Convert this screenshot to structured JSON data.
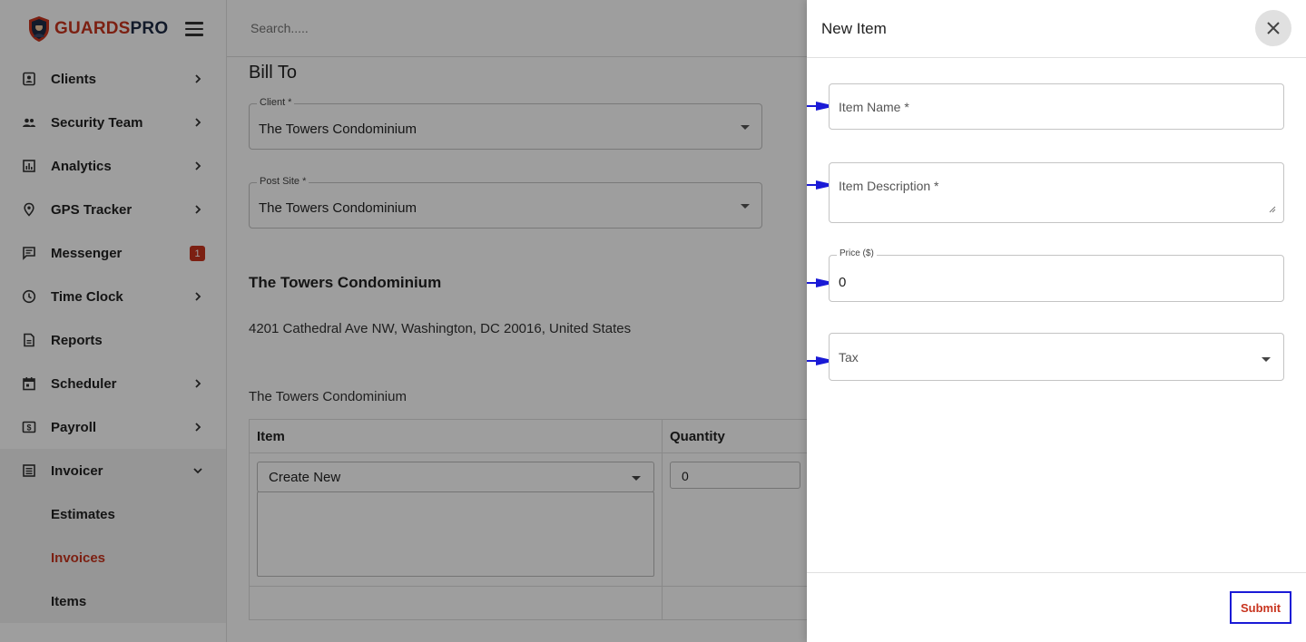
{
  "brand": {
    "logo_part1": "GUARDS",
    "logo_part2": "PRO"
  },
  "search": {
    "placeholder": "Search....."
  },
  "sidebar": {
    "items": [
      {
        "label": "Clients",
        "icon": "contact-icon",
        "chevron": true
      },
      {
        "label": "Security Team",
        "icon": "people-icon",
        "chevron": true
      },
      {
        "label": "Analytics",
        "icon": "bar-chart-icon",
        "chevron": true
      },
      {
        "label": "GPS Tracker",
        "icon": "location-pin-icon",
        "chevron": true
      },
      {
        "label": "Messenger",
        "icon": "chat-icon",
        "badge": "1"
      },
      {
        "label": "Time Clock",
        "icon": "clock-icon",
        "chevron": true
      },
      {
        "label": "Reports",
        "icon": "document-icon",
        "chevron": false
      },
      {
        "label": "Scheduler",
        "icon": "calendar-icon",
        "chevron": true
      },
      {
        "label": "Payroll",
        "icon": "dollar-icon",
        "chevron": true
      },
      {
        "label": "Invoicer",
        "icon": "list-icon",
        "chevron": "down"
      }
    ],
    "subitems": [
      {
        "label": "Estimates",
        "active": false
      },
      {
        "label": "Invoices",
        "active": true
      },
      {
        "label": "Items",
        "active": false
      }
    ]
  },
  "main": {
    "heading": "Bill To",
    "client_field": {
      "label": "Client *",
      "value": "The Towers Condominium"
    },
    "post_site_field": {
      "label": "Post Site *",
      "value": "The Towers Condominium"
    },
    "client_name": "The Towers Condominium",
    "address": "4201 Cathedral Ave NW, Washington, DC 20016, United States",
    "client_name_small": "The Towers Condominium",
    "table": {
      "headers": [
        "Item",
        "Quantity"
      ],
      "row": {
        "item_select": "Create New",
        "quantity": "0"
      }
    }
  },
  "drawer": {
    "title": "New Item",
    "item_name_placeholder": "Item Name *",
    "item_description_placeholder": "Item Description *",
    "price_label": "Price ($)",
    "price_value": "0",
    "tax_placeholder": "Tax",
    "submit_label": "Submit"
  },
  "colors": {
    "brand_red": "#c8341e",
    "brand_navy": "#1e2a44",
    "annotation_blue": "#1a1ad6"
  }
}
